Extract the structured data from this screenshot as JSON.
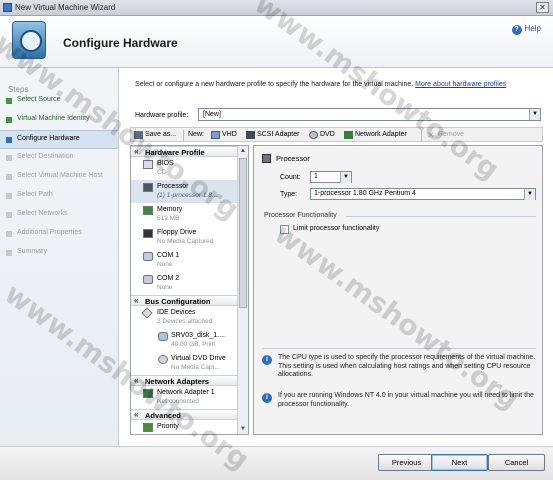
{
  "window": {
    "title": "New Virtual Machine Wizard",
    "close_glyph": "✕"
  },
  "header": {
    "page_title": "Configure Hardware",
    "help_label": "Help"
  },
  "steps": {
    "heading": "Steps",
    "items": [
      {
        "label": "Select Source",
        "state": "done"
      },
      {
        "label": "Virtual Machine Identity",
        "state": "done"
      },
      {
        "label": "Configure Hardware",
        "state": "active"
      },
      {
        "label": "Select Destination",
        "state": "pending"
      },
      {
        "label": "Select Virtual Machine Host",
        "state": "pending"
      },
      {
        "label": "Select Path",
        "state": "pending"
      },
      {
        "label": "Select Networks",
        "state": "pending"
      },
      {
        "label": "Additional Properties",
        "state": "pending"
      },
      {
        "label": "Summary",
        "state": "pending"
      }
    ]
  },
  "intro": {
    "text": "Select or configure a new hardware profile to specify the hardware for the virtual machine.",
    "link": "More about hardware profiles"
  },
  "profile": {
    "label": "Hardware profile:",
    "value": "[New]"
  },
  "toolbar": {
    "save_as": "Save as...",
    "new_label": "New:",
    "vhd": "VHD",
    "scsi": "SCSI Adapter",
    "dvd": "DVD",
    "network": "Network Adapter",
    "remove": "Remove"
  },
  "tree": {
    "hardware_profile": "Hardware Profile",
    "bios": {
      "name": "BIOS",
      "sub": "CD"
    },
    "processor": {
      "name": "Processor",
      "sub": "(1) 1-processor 1.8..."
    },
    "memory": {
      "name": "Memory",
      "sub": "512 MB"
    },
    "floppy": {
      "name": "Floppy Drive",
      "sub": "No Media Captured"
    },
    "com1": {
      "name": "COM 1",
      "sub": "None"
    },
    "com2": {
      "name": "COM 2",
      "sub": "None"
    },
    "bus_config": "Bus Configuration",
    "ide": {
      "name": "IDE Devices",
      "sub": "2 Devices attached"
    },
    "disk": {
      "name": "SRV03_disk_1....",
      "sub": "40.00 GB, Prim"
    },
    "vdvd": {
      "name": "Virtual DVD Drive",
      "sub": "No Media Capt..."
    },
    "network_adapters": "Network Adapters",
    "nic1": {
      "name": "Network Adapter 1",
      "sub": "Not connected"
    },
    "advanced": "Advanced",
    "priority": {
      "name": "Priority"
    }
  },
  "detail": {
    "title": "Processor",
    "count_label": "Count:",
    "count_value": "1",
    "type_label": "Type:",
    "type_value": "1-processor 1.80 GHz Pentium 4",
    "functionality_group": "Processor Functionality",
    "limit_label": "Limit processor functionality",
    "info1": "The CPU type is used to specify the processor requirements of the virtual machine.  This setting is used when calculating host ratings and when setting CPU resource allocations.",
    "info2": "If you are running Windows NT 4.0 in your virtual machine you will need to limit the processor functionality."
  },
  "footer": {
    "previous": "Previous",
    "next": "Next",
    "cancel": "Cancel"
  },
  "watermark": "www.mshowto.org",
  "colors": {
    "accent": "#2c6cc4",
    "done_step": "#3e9a3e",
    "selected_row": "#dbe4ee"
  }
}
